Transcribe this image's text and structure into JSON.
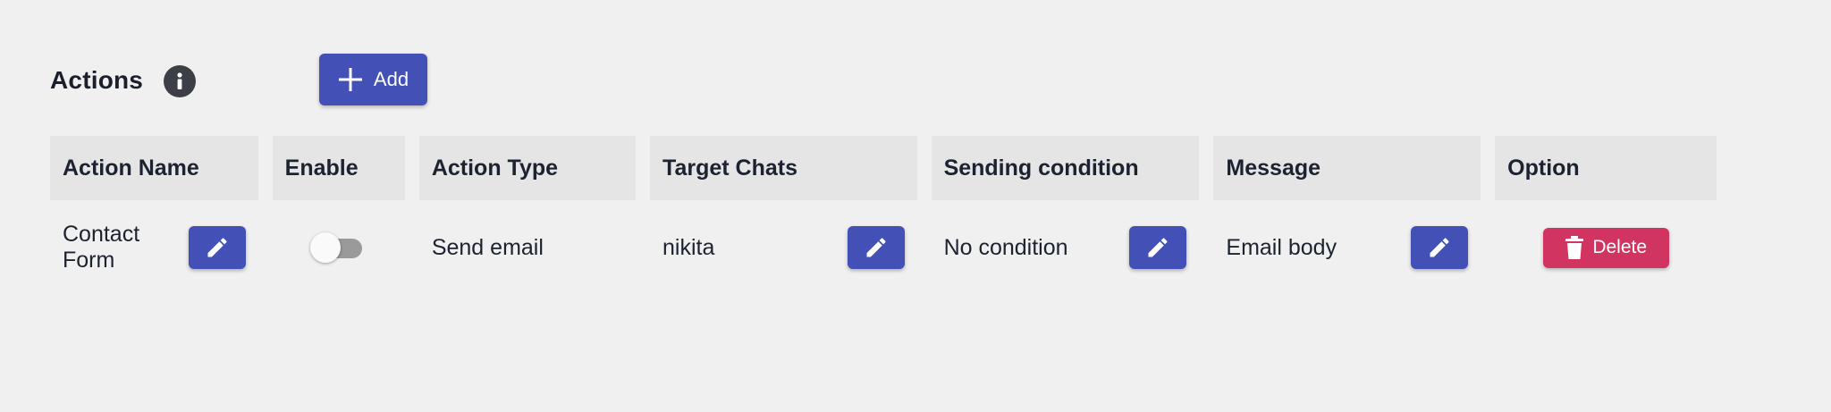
{
  "section": {
    "title": "Actions",
    "add_label": "Add"
  },
  "table": {
    "columns": [
      "Action Name",
      "Enable",
      "Action Type",
      "Target Chats",
      "Sending condition",
      "Message",
      "Option"
    ],
    "rows": [
      {
        "action_name": "Contact Form",
        "enabled": false,
        "action_type": "Send email",
        "target_chats": "nikita",
        "sending_condition": "No condition",
        "message": "Email body",
        "delete_label": "Delete"
      }
    ]
  },
  "colors": {
    "primary": "#4350b5",
    "danger": "#d23461",
    "header_bg": "#e5e5e5",
    "page_bg": "#f0f0f0"
  },
  "icons": {
    "info": "info-icon",
    "add": "plus-icon",
    "edit": "pencil-icon",
    "delete": "trash-icon"
  }
}
